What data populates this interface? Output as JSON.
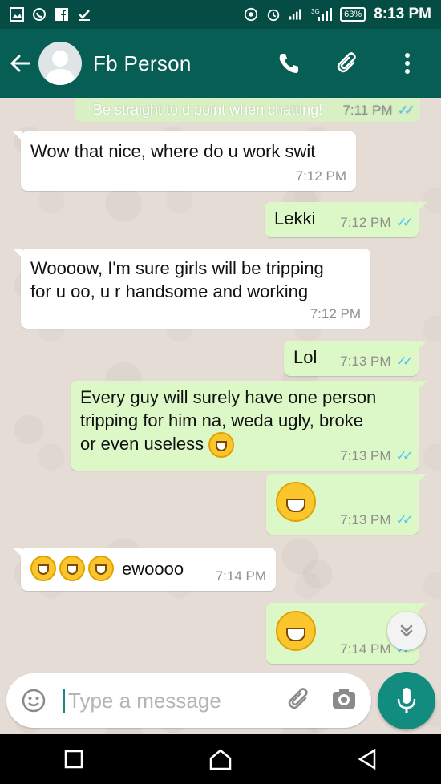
{
  "status_bar": {
    "time": "8:13 PM",
    "battery": "63%",
    "network": "3G"
  },
  "header": {
    "contact_name": "Fb Person"
  },
  "banner": {
    "text": "Be straight to d point when chatting!",
    "time": "7:11 PM"
  },
  "messages": [
    {
      "text": "Wow that nice, where do u work swit",
      "time": "7:12 PM"
    },
    {
      "text": "Lekki",
      "time": "7:12 PM"
    },
    {
      "line1": "Woooow, I'm sure girls will be tripping",
      "line2": "for u oo, u r handsome and working",
      "time": "7:12 PM"
    },
    {
      "text": "Lol",
      "time": "7:13 PM"
    },
    {
      "line1": "Every guy will surely have one person",
      "line2": "tripping for him na, weda ugly, broke",
      "line3": "or even useless",
      "time": "7:13 PM"
    },
    {
      "time": "7:13 PM"
    },
    {
      "text": "ewoooo",
      "time": "7:14 PM"
    },
    {
      "time": "7:14 PM"
    }
  ],
  "input": {
    "placeholder": "Type a message"
  },
  "colors": {
    "header": "#075e54",
    "statusbar": "#054d44",
    "outgoing": "#dcf8c6",
    "incoming": "#ffffff",
    "accent": "#128c7e",
    "ticks": "#4fc3f7"
  }
}
